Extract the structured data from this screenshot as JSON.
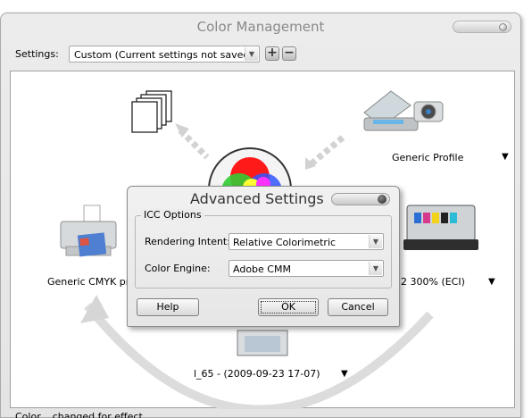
{
  "window": {
    "title": "Color Management"
  },
  "settings": {
    "label": "Settings:",
    "value": "Custom (Current settings not saved)"
  },
  "nodes": {
    "scanner_label": "Generic Profile",
    "printer_label": "Generic CMYK print",
    "proof_label": "2 300% (ECI)",
    "monitor_label": "l_65 - (2009-09-23 17-07)"
  },
  "status_text": "Color... changed for effect",
  "dialog": {
    "title": "Advanced Settings",
    "group_title": "ICC Options",
    "rendering_intent_label": "Rendering Intent:",
    "rendering_intent_value": "Relative Colorimetric",
    "color_engine_label": "Color Engine:",
    "color_engine_value": "Adobe CMM",
    "help_label": "Help",
    "ok_label": "OK",
    "cancel_label": "Cancel"
  }
}
